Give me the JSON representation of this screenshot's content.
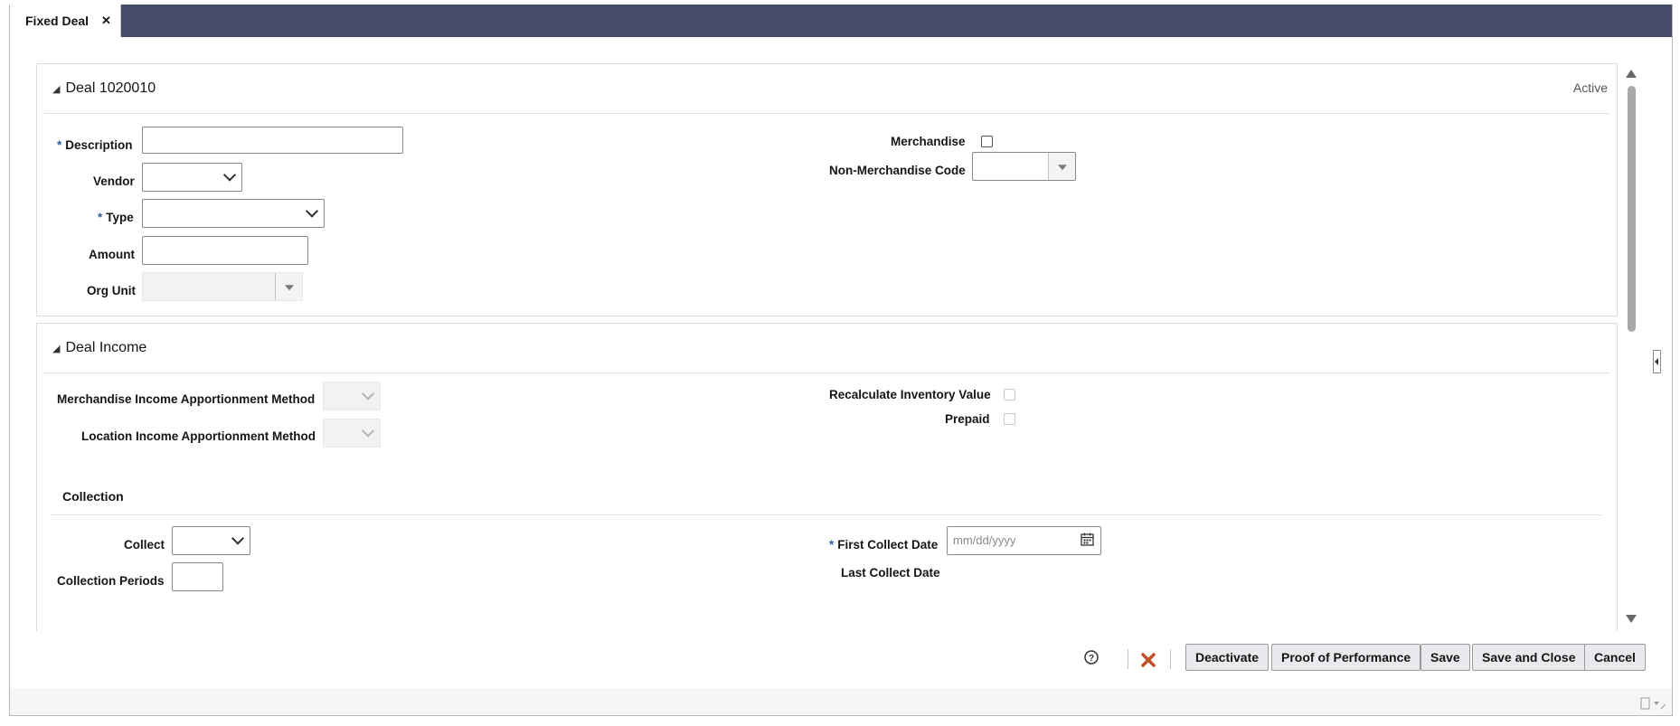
{
  "tab": {
    "label": "Fixed Deal",
    "close": "✕"
  },
  "deal": {
    "title": "Deal 1020010",
    "status": "Active",
    "description_label": "Description",
    "description_value": "",
    "vendor_label": "Vendor",
    "type_label": "Type",
    "amount_label": "Amount",
    "amount_value": "",
    "org_unit_label": "Org Unit",
    "merchandise_label": "Merchandise",
    "non_merch_label": "Non-Merchandise Code"
  },
  "income": {
    "title": "Deal Income",
    "merch_apportion_label": "Merchandise Income Apportionment Method",
    "loc_apportion_label": "Location Income Apportionment Method",
    "recalc_label": "Recalculate Inventory Value",
    "prepaid_label": "Prepaid",
    "collection_header": "Collection",
    "collect_label": "Collect",
    "periods_label": "Collection Periods",
    "periods_value": "",
    "first_collect_label": "First Collect Date",
    "first_collect_placeholder": "mm/dd/yyyy",
    "last_collect_label": "Last Collect Date"
  },
  "actions": {
    "help": "?",
    "deactivate": "Deactivate",
    "proof": "Proof of Performance",
    "save": "Save",
    "save_close": "Save and Close",
    "cancel": "Cancel"
  },
  "required_marker": "*",
  "colors": {
    "tabbar": "#474c6d",
    "required": "#2f5f9e",
    "delete": "#c2512a"
  }
}
